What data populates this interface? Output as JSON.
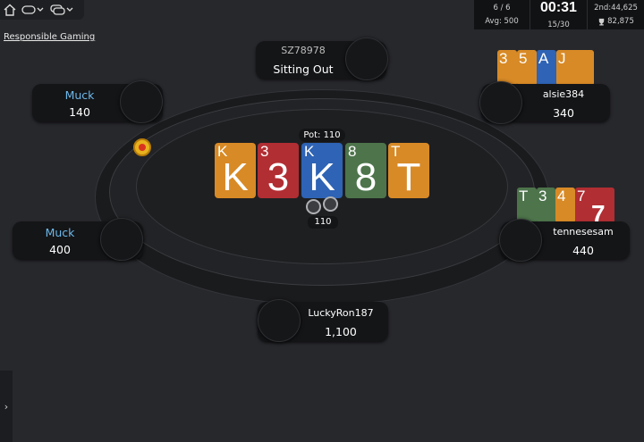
{
  "toolbar": {
    "home_icon": "home-icon",
    "chat_icon": "chat-icon",
    "tables_icon": "tables-icon"
  },
  "responsible_gaming": "Responsible Gaming",
  "stats": {
    "players": "6 / 6",
    "avg": "Avg: 500",
    "timer": "00:31",
    "blinds": "15/30",
    "second_prize": "2nd:44,625",
    "prize_pool": "82,875"
  },
  "seats": {
    "top": {
      "name": "SZ78978",
      "status": "Sitting Out"
    },
    "upper_left": {
      "name": "Muck",
      "stack": "140"
    },
    "left": {
      "name": "Muck",
      "stack": "400"
    },
    "upper_right": {
      "name": "alsie384",
      "stack": "340",
      "cards": [
        "3",
        "5",
        "A",
        "J"
      ]
    },
    "right": {
      "name": "tennesesam",
      "stack": "440",
      "cards": [
        "T",
        "3",
        "4",
        "7"
      ],
      "card_big": "7"
    },
    "bottom": {
      "name": "LuckyRon187",
      "stack": "1,100"
    }
  },
  "pot": "Pot: 110",
  "bet_amount": "110",
  "board": [
    {
      "rank": "K",
      "color": "orange"
    },
    {
      "rank": "3",
      "color": "red"
    },
    {
      "rank": "K",
      "color": "blue"
    },
    {
      "rank": "8",
      "color": "green"
    },
    {
      "rank": "T",
      "color": "orange"
    }
  ],
  "colors": {
    "orange": "#d88a26",
    "red": "#b12e33",
    "blue": "#2e63b5",
    "green": "#4d744b",
    "muck": "#6db8ea"
  }
}
